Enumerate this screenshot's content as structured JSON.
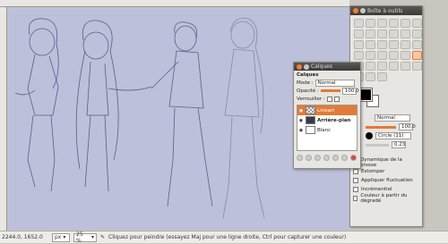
{
  "status": {
    "coords": "2244.0, 1652.0",
    "unit": "px",
    "zoom": "25 %",
    "message": "Cliquez pour peindre (essayez Maj pour une ligne droite, Ctrl pour capturer une couleur)"
  },
  "toolbox": {
    "title": "Boîte à outils"
  },
  "layers_dialog": {
    "title": "Calques",
    "section": "Calques",
    "mode_label": "Mode :",
    "mode_value": "Normal",
    "opacity_label": "Opacité :",
    "opacity_value": "100,0",
    "lock_label": "Verrouiller :",
    "layers": [
      {
        "name": "Lineart",
        "selected": true
      },
      {
        "name": "Arrière-plan",
        "selected": false
      },
      {
        "name": "Blanc",
        "selected": false
      }
    ]
  },
  "tool_options": {
    "mode_value": "Normal",
    "opacity_value": "100,0",
    "brush_value": "Circle (11)",
    "size_value": "0,23",
    "dynamics_label": "Dynamique de la brosse",
    "options": [
      "Estomper",
      "Appliquer fluctuation",
      "Incrémentiel",
      "Couleur à partir du dégradé"
    ]
  },
  "colors": {
    "accent": "#e07b39",
    "canvas": "#bcc0da"
  }
}
